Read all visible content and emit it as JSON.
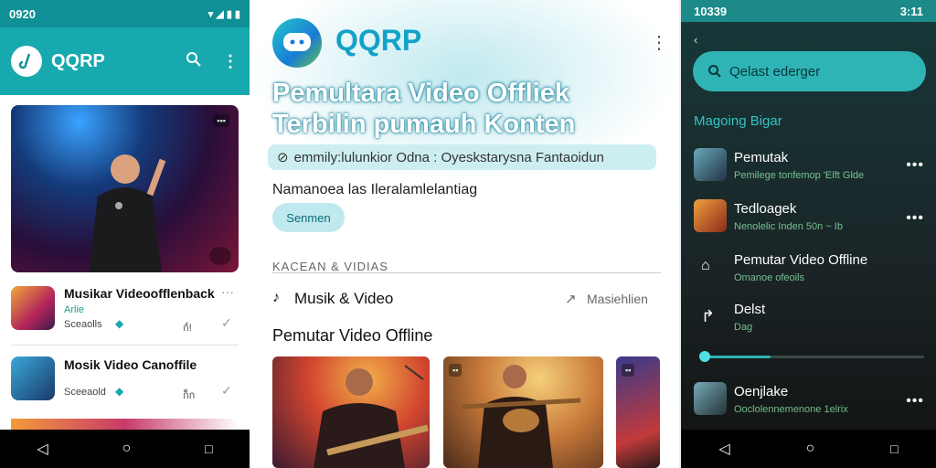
{
  "left": {
    "status_time": "0920",
    "app_title": "QQRP",
    "hero_badge_tl": "",
    "list": [
      {
        "title": "Musikar Videoofflenback",
        "line1": "Arlie",
        "line2": "Sceaolls",
        "count": "ก์!"
      },
      {
        "title": "Mosik Video Canoffile",
        "line1": "Sceeaold",
        "line2": "",
        "count": "ก็ก"
      }
    ]
  },
  "middle": {
    "app_title": "QQRP",
    "headline_1": "Pemultara Video Offliek",
    "headline_2": "Terbilin pumauh Konten",
    "search_text": "emmily:lulunkior Odna : Oyeskstarysna Fantaoidun",
    "subtitle": "Namanoea las Ileralamlelantiag",
    "chip": "Senmen",
    "section_label": "KACEAN & VIDIAS",
    "category": "Musik & Video",
    "category_link": "Masiehlien",
    "section_title": "Pemutar Video Offline"
  },
  "right": {
    "status_time": "10339",
    "status_right": "3:11",
    "search_placeholder": "Qelast ederger",
    "section_title": "Magoing Bigar",
    "items": [
      {
        "title": "Pemutak",
        "sub": "Pemilege tonfemop 'Elft Glde"
      },
      {
        "title": "Tedloagek",
        "sub": "Nenolelic Inden 50n ~ Ib"
      },
      {
        "title": "Pemutar Video Offline",
        "sub": "Omanoe ofeoils"
      },
      {
        "title": "Delst",
        "sub": "Dag"
      },
      {
        "title": "Oenjlake",
        "sub": "Ooclolennemenone 1elrix"
      }
    ],
    "progress": 0.3
  }
}
